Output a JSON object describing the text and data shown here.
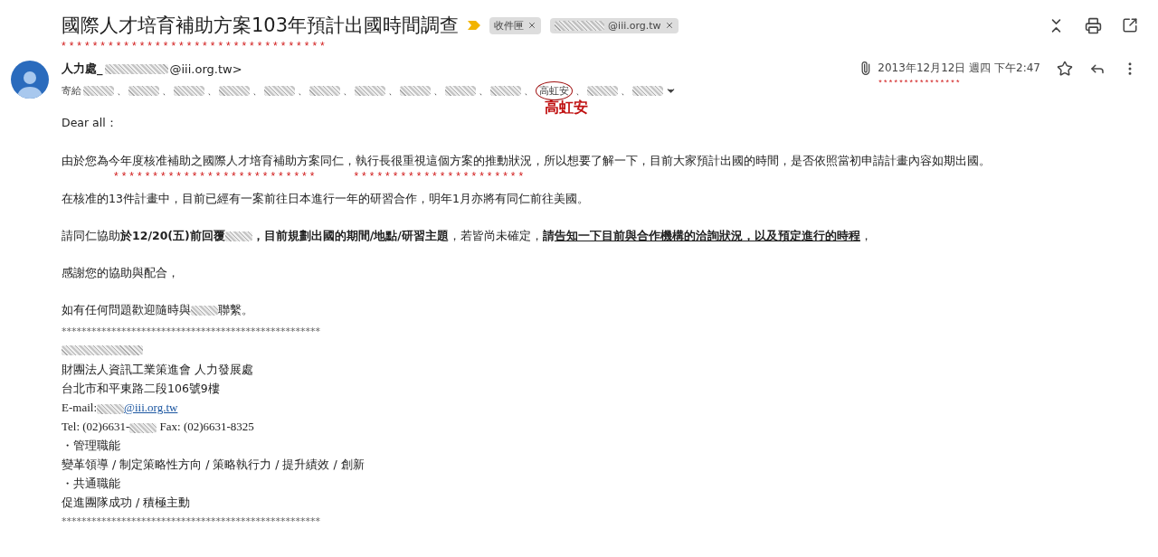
{
  "subject": {
    "title": "國際人才培育補助方案103年預計出國時間調查",
    "important": true,
    "annotation": "**********************************",
    "labels": [
      {
        "text": "收件匣",
        "redacted": false
      },
      {
        "text": "@iii.org.tw",
        "redacted": true
      }
    ]
  },
  "message": {
    "sender": {
      "name": "人力處_",
      "address": "@iii.org.tw>"
    },
    "to_prefix": "寄給",
    "recipients": [
      {
        "redacted": true,
        "separator": "、"
      },
      {
        "redacted": true,
        "separator": "、"
      },
      {
        "redacted": true,
        "separator": "、"
      },
      {
        "redacted": true,
        "separator": "、"
      },
      {
        "redacted": true,
        "separator": "、"
      },
      {
        "redacted": true,
        "separator": "、"
      },
      {
        "redacted": true,
        "separator": "、"
      },
      {
        "redacted": true,
        "separator": "、"
      },
      {
        "redacted": true,
        "separator": "、"
      },
      {
        "redacted": true,
        "separator": "、"
      },
      {
        "name": "高虹安",
        "redacted": false,
        "circled": true,
        "annotation": "高虹安",
        "separator": "、"
      },
      {
        "redacted": true,
        "separator": "、"
      },
      {
        "redacted": true
      }
    ],
    "has_attachment": true,
    "date": "2013年12月12日 週四 下午2:47",
    "date_annotation": "****************",
    "starred": false,
    "greeting": "Dear all：",
    "paragraphs": [
      {
        "segments": [
          {
            "kind": "text",
            "text": "由於您為今年度核准補助之國際人才培育補助方案同仁，執行長很重視這個方案的推動狀況，所以想要了解一下，目前大家預計出國的時間，是否依照當初申請計畫內容如期出國。"
          }
        ],
        "annotations": [
          "**************************",
          "**********************"
        ]
      },
      {
        "segments": [
          {
            "kind": "text",
            "text": "在核准的13件計畫中，目前已經有一案前往日本進行一年的研習合作，明年1月亦將有同仁前往美國。"
          }
        ]
      },
      {
        "segments": [
          {
            "kind": "text",
            "text": "請同仁協助"
          },
          {
            "kind": "text",
            "text": "於12/20(五)前回覆",
            "bold": true
          },
          {
            "kind": "redacted"
          },
          {
            "kind": "text",
            "text": "，目前規劃出國的期間/地點/研習主題",
            "bold": true
          },
          {
            "kind": "text",
            "text": "，若皆尚未確定，"
          },
          {
            "kind": "text",
            "text": "請",
            "bold": true
          },
          {
            "kind": "text",
            "text": "告知一下目前與合作機構的洽詢狀況，以及預定進行的時程",
            "bold": true,
            "underline": true
          },
          {
            "kind": "text",
            "text": "，"
          }
        ]
      },
      {
        "segments": [
          {
            "kind": "text",
            "text": "感謝您的協助與配合，"
          }
        ]
      },
      {
        "segments": [
          {
            "kind": "text",
            "text": "如有任何問題歡迎隨時與"
          },
          {
            "kind": "redacted"
          },
          {
            "kind": "text",
            "text": "聯繫。"
          }
        ]
      }
    ],
    "signature": [
      {
        "kind": "rule",
        "segments": [
          {
            "kind": "text",
            "text": "****************************************************"
          }
        ]
      },
      {
        "kind": "plain",
        "segments": [
          {
            "kind": "redacted"
          }
        ]
      },
      {
        "kind": "plain",
        "segments": [
          {
            "kind": "text",
            "text": "財團法人資訊工業策進會 人力發展處"
          }
        ]
      },
      {
        "kind": "plain",
        "segments": [
          {
            "kind": "text",
            "text": "台北市和平東路二段106號9樓"
          }
        ]
      },
      {
        "kind": "contact",
        "segments": [
          {
            "kind": "text",
            "text": "E-mail:"
          },
          {
            "kind": "redacted"
          },
          {
            "kind": "link",
            "text": "@iii.org.tw"
          }
        ]
      },
      {
        "kind": "contact",
        "segments": [
          {
            "kind": "text",
            "text": "Tel: (02)6631-"
          },
          {
            "kind": "redacted"
          },
          {
            "kind": "text",
            "text": " Fax: (02)6631-8325"
          }
        ]
      },
      {
        "kind": "plain",
        "segments": [
          {
            "kind": "text",
            "text": "・管理職能"
          }
        ]
      },
      {
        "kind": "plain",
        "segments": [
          {
            "kind": "text",
            "text": "變革領導 / 制定策略性方向 / 策略執行力 / 提升績效 / 創新"
          }
        ]
      },
      {
        "kind": "plain",
        "segments": [
          {
            "kind": "text",
            "text": "・共通職能"
          }
        ]
      },
      {
        "kind": "plain",
        "segments": [
          {
            "kind": "text",
            "text": "促進團隊成功 / 積極主動"
          }
        ]
      },
      {
        "kind": "rule",
        "segments": [
          {
            "kind": "text",
            "text": "****************************************************"
          }
        ]
      }
    ]
  }
}
